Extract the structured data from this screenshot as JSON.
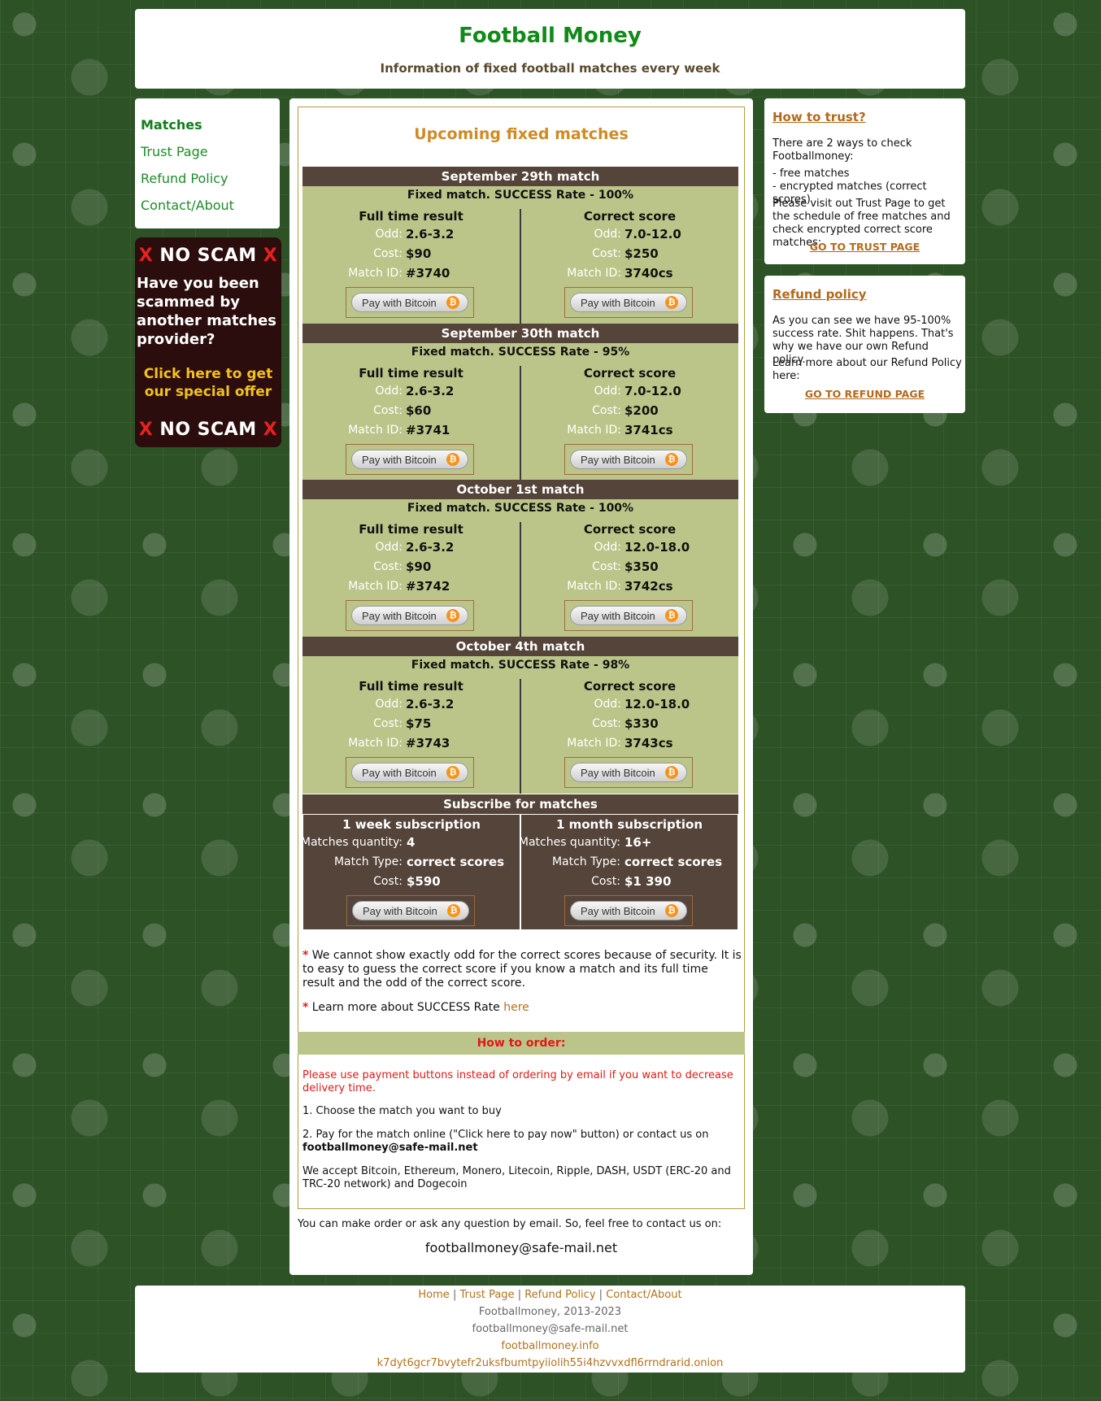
{
  "header": {
    "title": "Football Money",
    "subtitle": "Information of fixed football matches every week"
  },
  "nav": {
    "items": [
      {
        "label": "Matches",
        "active": true
      },
      {
        "label": "Trust Page"
      },
      {
        "label": "Refund Policy"
      },
      {
        "label": "Contact/About"
      }
    ]
  },
  "ad": {
    "x": "X",
    "no_scam": "NO SCAM",
    "question": "Have you been scammed by another matches provider?",
    "offer": "Click here to get our special offer"
  },
  "main": {
    "title": "Upcoming fixed matches",
    "col_left": "Full time result",
    "col_right": "Correct score",
    "odd_label": "Odd:",
    "cost_label": "Cost:",
    "match_id_label": "Match ID:",
    "pay_button": "Pay with Bitcoin",
    "btc_symbol": "₿",
    "matches": [
      {
        "heading": "September 29th match",
        "rate": "Fixed match. SUCCESS Rate - 100%",
        "ft": {
          "odd": "2.6-3.2",
          "cost": "$90",
          "id": "#3740"
        },
        "cs": {
          "odd": "7.0-12.0",
          "cost": "$250",
          "id": "3740cs"
        }
      },
      {
        "heading": "September 30th match",
        "rate": "Fixed match. SUCCESS Rate - 95%",
        "ft": {
          "odd": "2.6-3.2",
          "cost": "$60",
          "id": "#3741"
        },
        "cs": {
          "odd": "7.0-12.0",
          "cost": "$200",
          "id": "3741cs"
        }
      },
      {
        "heading": "October 1st match",
        "rate": "Fixed match. SUCCESS Rate - 100%",
        "ft": {
          "odd": "2.6-3.2",
          "cost": "$90",
          "id": "#3742"
        },
        "cs": {
          "odd": "12.0-18.0",
          "cost": "$350",
          "id": "3742cs"
        }
      },
      {
        "heading": "October 4th match",
        "rate": "Fixed match. SUCCESS Rate - 98%",
        "ft": {
          "odd": "2.6-3.2",
          "cost": "$75",
          "id": "#3743"
        },
        "cs": {
          "odd": "12.0-18.0",
          "cost": "$330",
          "id": "3743cs"
        }
      }
    ],
    "subscribe": {
      "heading": "Subscribe for matches",
      "qty_label": "Matches quantity:",
      "type_label": "Match Type:",
      "cost_label": "Cost:",
      "plans": [
        {
          "title": "1 week subscription",
          "qty": "4",
          "type": "correct scores",
          "cost": "$590"
        },
        {
          "title": "1 month subscription",
          "qty": "16+",
          "type": "correct scores",
          "cost": "$1 390"
        }
      ]
    },
    "notes": {
      "star": "*",
      "note1": "We cannot show exactly odd for the correct scores because of security. It is to easy to guess the correct score if you know a match and its full time result and the odd of the correct score.",
      "note2": "Learn more about SUCCESS Rate",
      "note2_link": "here"
    },
    "order": {
      "heading": "How to order:",
      "warning": "Please use payment buttons instead of ordering by email if you want to decrease delivery time.",
      "step1": "1. Choose the match you want to buy",
      "step2": "2. Pay for the match online (\"Click here to pay now\" button) or contact us on",
      "step2_email": "footballmoney@safe-mail.net",
      "accept": "We accept Bitcoin, Ethereum, Monero, Litecoin, Ripple, DASH, USDT (ERC-20 and TRC-20 network) and Dogecoin"
    },
    "contact_text": "You can make order or ask any question by email. So, feel free to contact us on:",
    "contact_email": "footballmoney@safe-mail.net"
  },
  "trust": {
    "title": "How to trust?",
    "p1": "There are 2 ways to check Footballmoney:",
    "p2": "- free matches\n- encrypted matches (correct scores)",
    "p3": "Please visit out Trust Page to get the schedule of free matches and check encrypted correct score matches:",
    "link": "GO TO TRUST PAGE"
  },
  "refund": {
    "title": "Refund policy",
    "p1": "As you can see we have 95-100% success rate. Shit happens. That's why we have our own Refund policy.",
    "p2": "Learn more about our Refund Policy here:",
    "link": "GO TO REFUND PAGE"
  },
  "footer": {
    "links": [
      "Home",
      "Trust Page",
      "Refund Policy",
      "Contact/About"
    ],
    "sep": "|",
    "copyright": "Footballmoney, 2013-2023",
    "email": "footballmoney@safe-mail.net",
    "site": "footballmoney.info",
    "onion": "k7dyt6gcr7bvytefr2uksfbumtpyiiolih55i4hzvvxdfl6rrndrarid.onion"
  }
}
